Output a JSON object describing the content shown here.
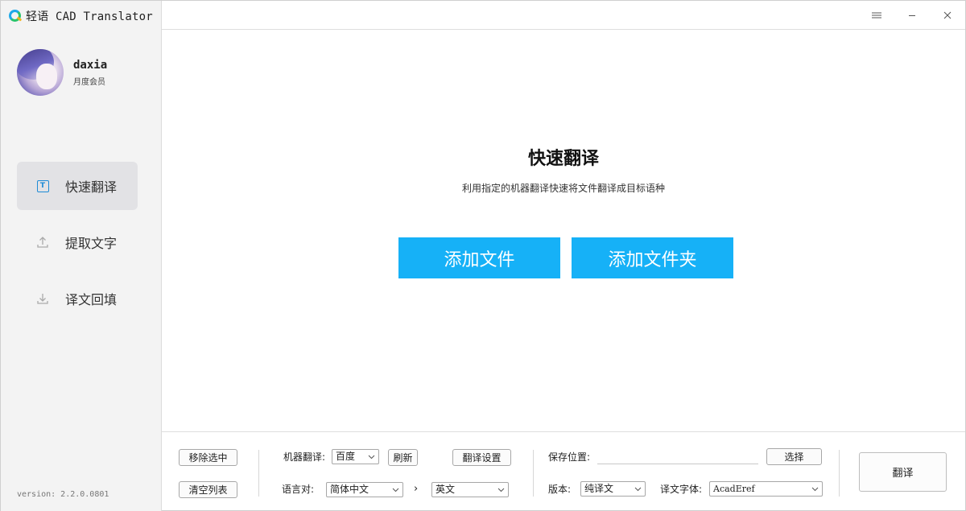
{
  "app": {
    "title": "轻语 CAD Translator",
    "version": "version: 2.2.0.0801"
  },
  "user": {
    "name": "daxia",
    "level": "月度会员"
  },
  "nav": [
    {
      "label": "快速翻译",
      "icon": "text-t-icon",
      "active": true
    },
    {
      "label": "提取文字",
      "icon": "upload-icon",
      "active": false
    },
    {
      "label": "译文回填",
      "icon": "download-icon",
      "active": false
    }
  ],
  "main": {
    "title": "快速翻译",
    "subtitle": "利用指定的机器翻译快速将文件翻译成目标语种",
    "add_file": "添加文件",
    "add_folder": "添加文件夹"
  },
  "bottom": {
    "remove_selected": "移除选中",
    "clear_list": "清空列表",
    "machine_label": "机器翻译:",
    "machine_value": "百度",
    "refresh": "刷新",
    "settings": "翻译设置",
    "lang_label": "语言对:",
    "source_lang": "简体中文",
    "lang_arrow": "›",
    "target_lang": "英文",
    "save_label": "保存位置:",
    "save_path": "",
    "choose": "选择",
    "version_label": "版本:",
    "version_value": "纯译文",
    "font_label": "译文字体:",
    "font_value": "AcadEref",
    "translate": "翻译"
  },
  "colors": {
    "accent": "#16b1f7",
    "sidebar_bg": "#f3f3f3",
    "active_nav": "#e2e2e5",
    "icon_blue": "#1e8bd6"
  }
}
